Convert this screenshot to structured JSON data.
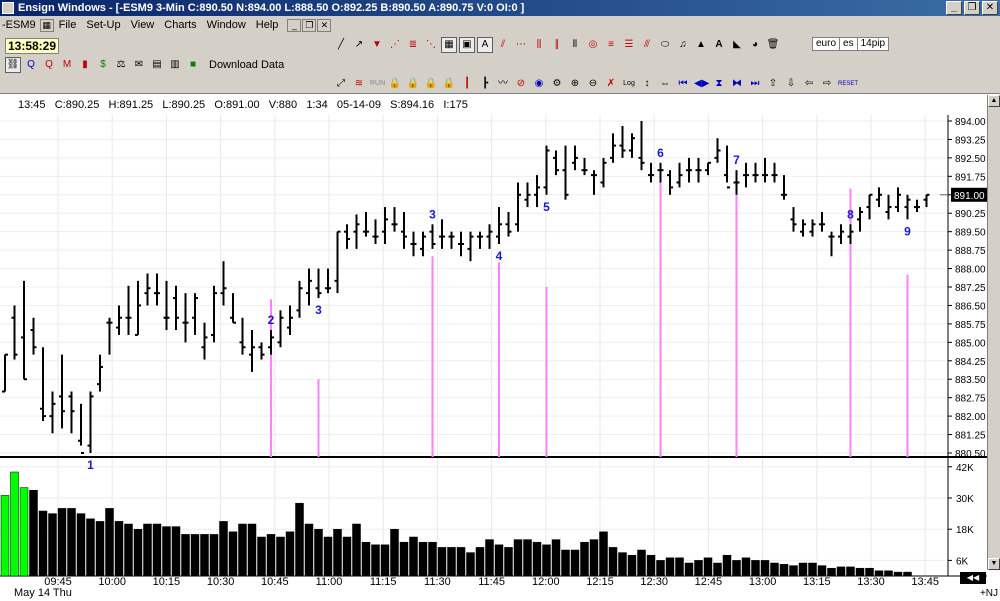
{
  "window": {
    "title": "Ensign Windows - [-ESM9 3-Min C:890.50 N:894.00 L:888.50 O:892.25 B:890.50 A:890.75 V:0 OI:0 ]",
    "minimize": "_",
    "restore": "❐",
    "close": "✕"
  },
  "menu": {
    "symbol": "-ESM9",
    "items": [
      "File",
      "Set-Up",
      "View",
      "Charts",
      "Window",
      "Help"
    ],
    "mdi": [
      "_",
      "❐",
      "✕"
    ]
  },
  "toolbar": {
    "clock": "13:58:29",
    "download_label": "Download Data",
    "tabs": [
      "euro",
      "es",
      "14pip"
    ],
    "run_label": "RUN",
    "log_label": "Log",
    "reset_label": "RESET"
  },
  "info": {
    "time": "13:45",
    "close": "C:890.25",
    "high": "H:891.25",
    "low": "L:890.25",
    "open": "O:891.00",
    "volume": "V:880",
    "countdown": "1:34",
    "date": "05-14-09",
    "s_value": "S:894.16",
    "i_value": "I:175"
  },
  "bottom": {
    "date_label": "May 14 Thu",
    "nj_label": "+NJ"
  },
  "chart_data": {
    "type": "ohlc",
    "price_axis": {
      "ticks": [
        "894.00",
        "893.25",
        "892.50",
        "891.75",
        "891.00",
        "890.25",
        "889.50",
        "888.75",
        "888.00",
        "887.25",
        "886.50",
        "885.75",
        "885.00",
        "884.25",
        "883.50",
        "882.75",
        "882.00",
        "881.25",
        "880.50"
      ],
      "min": 880.5,
      "max": 894.0,
      "last_price_label": "891.00",
      "last_price": 891.0
    },
    "volume_axis": {
      "ticks": [
        "42K",
        "30K",
        "18K",
        "6K"
      ],
      "values": [
        42000,
        30000,
        18000,
        6000
      ],
      "max": 45000
    },
    "time_labels": [
      "09:45",
      "10:00",
      "10:15",
      "10:30",
      "10:45",
      "11:00",
      "11:15",
      "11:30",
      "11:45",
      "12:00",
      "12:15",
      "12:30",
      "12:45",
      "13:00",
      "13:15",
      "13:30",
      "13:45"
    ],
    "bars": [
      [
        884.5,
        883.0,
        883.0,
        884.5
      ],
      [
        886.5,
        884.3,
        886.0,
        884.5
      ],
      [
        887.5,
        883.5,
        885.2,
        883.5
      ],
      [
        886.0,
        884.5,
        885.5,
        884.8
      ],
      [
        884.8,
        881.8,
        882.3,
        882.0
      ],
      [
        883.0,
        881.3,
        882.0,
        882.5
      ],
      [
        884.5,
        881.5,
        882.8,
        882.2
      ],
      [
        883.0,
        881.3,
        882.8,
        882.2
      ],
      [
        882.5,
        880.8,
        881.0,
        880.5
      ],
      [
        883.0,
        880.5,
        880.8,
        882.8
      ],
      [
        884.5,
        883.0,
        883.3,
        884.0
      ],
      [
        886.0,
        884.5,
        885.8,
        885.8
      ],
      [
        886.5,
        885.3,
        885.6,
        886.0
      ],
      [
        887.3,
        885.3,
        886.0,
        886.0
      ],
      [
        887.5,
        885.3,
        885.3,
        886.5
      ],
      [
        887.8,
        886.5,
        887.0,
        887.2
      ],
      [
        887.8,
        886.5,
        887.0,
        887.0
      ],
      [
        887.5,
        885.5,
        886.0,
        886.0
      ],
      [
        887.3,
        885.5,
        886.8,
        886.0
      ],
      [
        887.0,
        885.0,
        885.8,
        885.8
      ],
      [
        887.0,
        885.3,
        886.0,
        886.8
      ],
      [
        885.8,
        884.3,
        884.8,
        885.2
      ],
      [
        887.3,
        885.0,
        885.3,
        887.0
      ],
      [
        888.3,
        886.5,
        887.0,
        887.2
      ],
      [
        887.0,
        885.8,
        886.0,
        885.8
      ],
      [
        886.0,
        884.5,
        885.0,
        884.8
      ],
      [
        885.5,
        883.8,
        884.5,
        884.8
      ],
      [
        885.0,
        884.3,
        884.8,
        884.5
      ],
      [
        885.5,
        884.5,
        884.8,
        885.2
      ],
      [
        886.3,
        884.8,
        885.0,
        886.0
      ],
      [
        886.5,
        885.3,
        885.6,
        886.0
      ],
      [
        887.5,
        886.0,
        886.3,
        887.2
      ],
      [
        888.0,
        886.5,
        887.0,
        887.5
      ],
      [
        888.0,
        886.8,
        887.2,
        887.0
      ],
      [
        888.0,
        887.0,
        887.2,
        887.2
      ],
      [
        889.5,
        887.0,
        887.5,
        889.5
      ],
      [
        889.8,
        888.8,
        889.5,
        889.2
      ],
      [
        890.2,
        888.8,
        889.5,
        889.8
      ],
      [
        890.3,
        889.3,
        889.5,
        889.5
      ],
      [
        890.0,
        889.0,
        889.3,
        889.3
      ],
      [
        890.5,
        889.0,
        889.5,
        890.0
      ],
      [
        890.5,
        889.5,
        889.8,
        889.8
      ],
      [
        890.3,
        888.8,
        889.5,
        889.3
      ],
      [
        889.5,
        888.5,
        889.0,
        889.0
      ],
      [
        889.5,
        888.5,
        888.8,
        889.3
      ],
      [
        889.8,
        888.8,
        889.5,
        889.0
      ],
      [
        890.0,
        888.8,
        889.3,
        889.3
      ],
      [
        889.5,
        888.8,
        889.3,
        889.3
      ],
      [
        889.5,
        888.5,
        889.0,
        889.0
      ],
      [
        889.5,
        888.3,
        888.8,
        889.3
      ],
      [
        889.5,
        888.8,
        889.3,
        889.3
      ],
      [
        889.8,
        888.8,
        889.3,
        889.5
      ],
      [
        890.5,
        889.0,
        889.3,
        889.8
      ],
      [
        890.3,
        889.3,
        889.8,
        889.5
      ],
      [
        891.5,
        889.5,
        889.8,
        891.0
      ],
      [
        891.5,
        890.5,
        890.8,
        891.0
      ],
      [
        891.8,
        890.5,
        891.0,
        891.3
      ],
      [
        893.0,
        891.0,
        891.3,
        892.8
      ],
      [
        892.8,
        891.8,
        892.5,
        892.0
      ],
      [
        893.0,
        890.8,
        892.0,
        891.0
      ],
      [
        893.0,
        892.0,
        892.3,
        892.5
      ],
      [
        892.5,
        891.8,
        892.0,
        892.0
      ],
      [
        892.0,
        891.0,
        891.8,
        891.8
      ],
      [
        892.5,
        891.3,
        891.5,
        892.3
      ],
      [
        893.5,
        892.3,
        892.5,
        893.0
      ],
      [
        893.8,
        892.5,
        893.0,
        892.8
      ],
      [
        893.5,
        892.5,
        892.8,
        893.3
      ],
      [
        894.0,
        892.0,
        892.5,
        892.3
      ],
      [
        892.3,
        891.5,
        891.8,
        891.8
      ],
      [
        892.3,
        891.5,
        892.0,
        892.0
      ],
      [
        892.0,
        891.0,
        891.8,
        891.3
      ],
      [
        892.3,
        891.3,
        891.5,
        891.8
      ],
      [
        892.5,
        891.5,
        892.0,
        892.0
      ],
      [
        892.5,
        891.5,
        892.0,
        892.0
      ],
      [
        892.3,
        891.8,
        892.0,
        892.3
      ],
      [
        893.3,
        892.3,
        892.5,
        892.8
      ],
      [
        893.0,
        891.5,
        891.8,
        891.3
      ],
      [
        892.0,
        891.0,
        891.5,
        891.5
      ],
      [
        892.3,
        891.3,
        891.8,
        891.8
      ],
      [
        892.3,
        891.5,
        891.8,
        891.8
      ],
      [
        892.5,
        891.5,
        891.8,
        891.8
      ],
      [
        892.3,
        891.5,
        891.8,
        891.8
      ],
      [
        891.8,
        890.8,
        891.0,
        891.0
      ],
      [
        890.5,
        889.5,
        890.0,
        889.8
      ],
      [
        890.0,
        889.3,
        889.5,
        889.8
      ],
      [
        890.0,
        889.3,
        889.5,
        889.8
      ],
      [
        890.3,
        889.5,
        889.8,
        889.8
      ],
      [
        889.5,
        888.5,
        889.3,
        889.3
      ],
      [
        889.8,
        889.0,
        889.3,
        889.5
      ],
      [
        889.8,
        889.0,
        889.3,
        889.5
      ],
      [
        890.5,
        889.5,
        890.0,
        890.3
      ],
      [
        891.0,
        890.0,
        890.5,
        891.0
      ],
      [
        891.3,
        890.5,
        890.8,
        891.0
      ],
      [
        891.0,
        890.0,
        890.3,
        890.5
      ],
      [
        891.3,
        890.3,
        890.5,
        891.0
      ],
      [
        891.0,
        890.0,
        890.5,
        890.8
      ],
      [
        890.8,
        890.3,
        890.5,
        890.5
      ],
      [
        891.0,
        890.5,
        890.8,
        891.0
      ]
    ],
    "volumes": [
      [
        31000,
        "green"
      ],
      [
        40000,
        "green"
      ],
      [
        34000,
        "green"
      ],
      [
        33000,
        "black"
      ],
      [
        25000,
        "black"
      ],
      [
        24000,
        "black"
      ],
      [
        26000,
        "black"
      ],
      [
        26000,
        "black"
      ],
      [
        24000,
        "black"
      ],
      [
        22000,
        "black"
      ],
      [
        21000,
        "black"
      ],
      [
        26000,
        "black"
      ],
      [
        21000,
        "black"
      ],
      [
        20000,
        "black"
      ],
      [
        18000,
        "black"
      ],
      [
        20000,
        "black"
      ],
      [
        20000,
        "black"
      ],
      [
        19000,
        "black"
      ],
      [
        19000,
        "black"
      ],
      [
        16000,
        "black"
      ],
      [
        16000,
        "black"
      ],
      [
        16000,
        "black"
      ],
      [
        16000,
        "black"
      ],
      [
        21000,
        "black"
      ],
      [
        17000,
        "black"
      ],
      [
        20000,
        "black"
      ],
      [
        20000,
        "black"
      ],
      [
        15000,
        "black"
      ],
      [
        16000,
        "black"
      ],
      [
        15000,
        "black"
      ],
      [
        17000,
        "black"
      ],
      [
        28000,
        "black"
      ],
      [
        20000,
        "black"
      ],
      [
        18000,
        "black"
      ],
      [
        15000,
        "black"
      ],
      [
        18000,
        "black"
      ],
      [
        15000,
        "black"
      ],
      [
        20000,
        "black"
      ],
      [
        13000,
        "black"
      ],
      [
        12000,
        "black"
      ],
      [
        12000,
        "black"
      ],
      [
        18000,
        "black"
      ],
      [
        13000,
        "black"
      ],
      [
        15000,
        "black"
      ],
      [
        13000,
        "black"
      ],
      [
        13000,
        "black"
      ],
      [
        11000,
        "black"
      ],
      [
        11000,
        "black"
      ],
      [
        11000,
        "black"
      ],
      [
        9000,
        "black"
      ],
      [
        11000,
        "black"
      ],
      [
        14000,
        "black"
      ],
      [
        12000,
        "black"
      ],
      [
        11000,
        "black"
      ],
      [
        14000,
        "black"
      ],
      [
        14000,
        "black"
      ],
      [
        13000,
        "black"
      ],
      [
        12000,
        "black"
      ],
      [
        14000,
        "black"
      ],
      [
        10000,
        "black"
      ],
      [
        10000,
        "black"
      ],
      [
        13000,
        "black"
      ],
      [
        14000,
        "black"
      ],
      [
        17000,
        "black"
      ],
      [
        11000,
        "black"
      ],
      [
        9000,
        "black"
      ],
      [
        8000,
        "black"
      ],
      [
        10000,
        "black"
      ],
      [
        8000,
        "black"
      ],
      [
        6000,
        "black"
      ],
      [
        7000,
        "black"
      ],
      [
        7000,
        "black"
      ],
      [
        5000,
        "black"
      ],
      [
        6000,
        "black"
      ],
      [
        7000,
        "black"
      ],
      [
        5000,
        "black"
      ],
      [
        8000,
        "black"
      ],
      [
        6000,
        "black"
      ],
      [
        7000,
        "black"
      ],
      [
        6000,
        "black"
      ],
      [
        6000,
        "black"
      ],
      [
        5000,
        "black"
      ],
      [
        4500,
        "black"
      ],
      [
        4000,
        "black"
      ],
      [
        5000,
        "black"
      ],
      [
        5000,
        "black"
      ],
      [
        4000,
        "black"
      ],
      [
        3000,
        "black"
      ],
      [
        3500,
        "black"
      ],
      [
        3500,
        "black"
      ],
      [
        3000,
        "black"
      ],
      [
        3000,
        "black"
      ],
      [
        2000,
        "black"
      ],
      [
        2000,
        "black"
      ],
      [
        1500,
        "black"
      ],
      [
        1500,
        "black"
      ]
    ],
    "annotations": [
      {
        "label": "1",
        "bar": 9,
        "place": "below"
      },
      {
        "label": "2",
        "bar": 28,
        "place": "above"
      },
      {
        "label": "3",
        "bar": 33,
        "place": "below"
      },
      {
        "label": "3",
        "bar": 45,
        "place": "above"
      },
      {
        "label": "4",
        "bar": 52,
        "place": "below"
      },
      {
        "label": "5",
        "bar": 57,
        "place": "below"
      },
      {
        "label": "6",
        "bar": 69,
        "place": "above"
      },
      {
        "label": "7",
        "bar": 77,
        "place": "above"
      },
      {
        "label": "8",
        "bar": 89,
        "place": "above"
      },
      {
        "label": "9",
        "bar": 95,
        "place": "below"
      }
    ],
    "pink_lines": [
      {
        "bar": 28,
        "top": 886.75
      },
      {
        "bar": 33,
        "top": 883.5
      },
      {
        "bar": 45,
        "top": 888.5
      },
      {
        "bar": 52,
        "top": 888.25
      },
      {
        "bar": 57,
        "top": 887.25
      },
      {
        "bar": 69,
        "top": 891.5
      },
      {
        "bar": 77,
        "top": 891.75
      },
      {
        "bar": 89,
        "top": 891.25
      },
      {
        "bar": 95,
        "top": 887.75
      }
    ]
  }
}
